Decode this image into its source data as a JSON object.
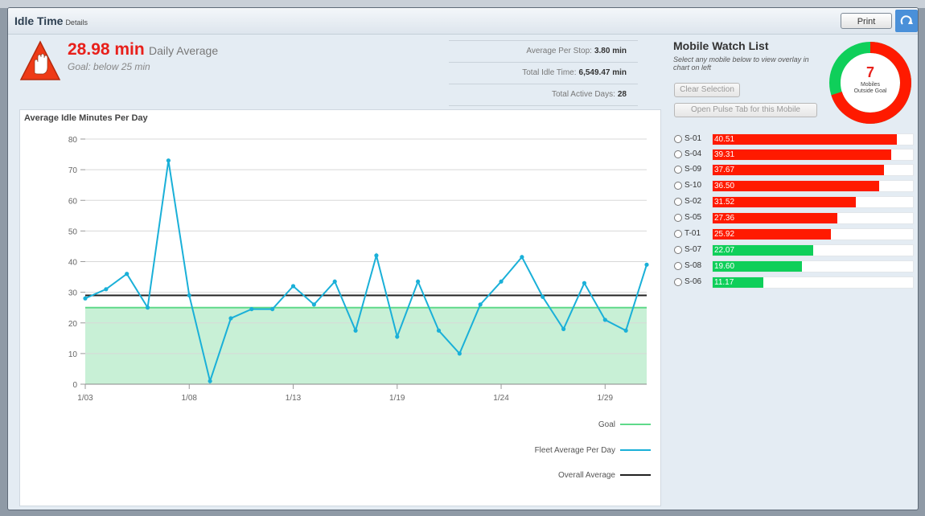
{
  "window": {
    "title": "Idle Time",
    "title_sub": "Details",
    "print_label": "Print",
    "corner_icon": "refresh-icon"
  },
  "summary": {
    "value": "28.98 min",
    "label": "Daily Average",
    "goal": "Goal: below 25 min",
    "icon": "warning-hand-icon",
    "stats": [
      {
        "label": "Average Per Stop:",
        "value": "3.80 min"
      },
      {
        "label": "Total Idle Time:",
        "value": "6,549.47 min"
      },
      {
        "label": "Total Active Days:",
        "value": "28"
      }
    ]
  },
  "chart_data": {
    "type": "line",
    "title": "Average Idle Minutes Per Day",
    "x_tick_labels": [
      "1/03",
      "1/08",
      "1/13",
      "1/19",
      "1/24",
      "1/29"
    ],
    "y_ticks": [
      0,
      10,
      20,
      30,
      40,
      50,
      60,
      70,
      80
    ],
    "ylim": [
      0,
      80
    ],
    "grid": true,
    "goal": 25,
    "overall_average": 29,
    "series": [
      {
        "name": "Fleet Average Per Day",
        "color": "#1ab0d8",
        "values": [
          28,
          31,
          36,
          25,
          73,
          29,
          1,
          21.5,
          24.5,
          24.5,
          32,
          26,
          33.5,
          17.5,
          42,
          15.5,
          33.5,
          17.5,
          10,
          26,
          33.5,
          41.5,
          28.5,
          18,
          33,
          21,
          17.5,
          39
        ]
      }
    ],
    "legend": [
      {
        "label": "Goal",
        "color": "#5fd98a"
      },
      {
        "label": "Fleet Average Per Day",
        "color": "#1ab0d8"
      },
      {
        "label": "Overall Average",
        "color": "#222222"
      }
    ],
    "goal_fill": "#c8f0d6"
  },
  "watchlist": {
    "title": "Mobile Watch List",
    "desc": "Select any mobile below to view overlay in chart on left",
    "clear_label": "Clear Selection",
    "pulse_label": "Open Pulse Tab for this Mobile",
    "donut_value": "7",
    "donut_label_1": "Mobiles",
    "donut_label_2": "Outside Goal",
    "donut_outside_fraction": 0.7,
    "bar_max": 44,
    "mobiles": [
      {
        "id": "S-01",
        "value": "40.51",
        "color": "#ff1a00"
      },
      {
        "id": "S-04",
        "value": "39.31",
        "color": "#ff1a00"
      },
      {
        "id": "S-09",
        "value": "37.67",
        "color": "#ff1a00"
      },
      {
        "id": "S-10",
        "value": "36.50",
        "color": "#ff1a00"
      },
      {
        "id": "S-02",
        "value": "31.52",
        "color": "#ff1a00"
      },
      {
        "id": "S-05",
        "value": "27.36",
        "color": "#ff1a00"
      },
      {
        "id": "T-01",
        "value": "25.92",
        "color": "#ff1a00"
      },
      {
        "id": "S-07",
        "value": "22.07",
        "color": "#0fcf5a"
      },
      {
        "id": "S-08",
        "value": "19.60",
        "color": "#0fcf5a"
      },
      {
        "id": "S-06",
        "value": "11.17",
        "color": "#0fcf5a"
      }
    ]
  }
}
